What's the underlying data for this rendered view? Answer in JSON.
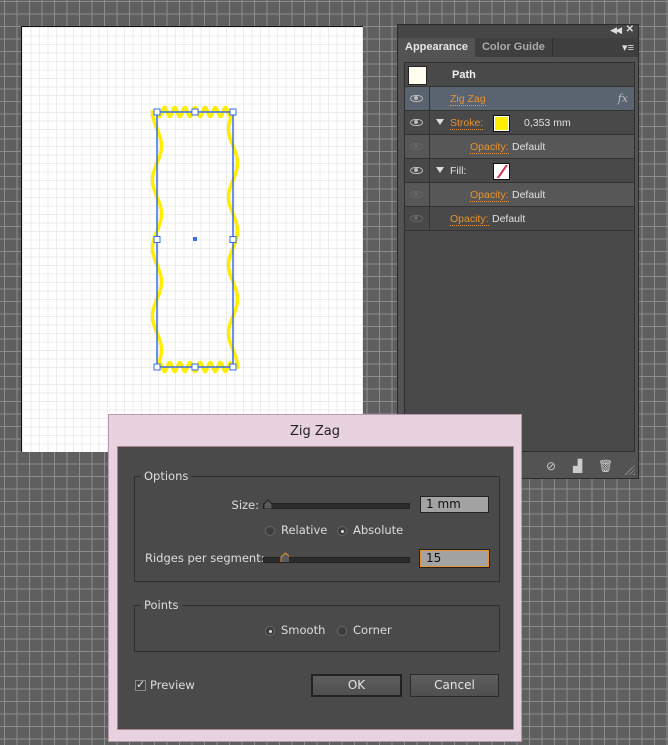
{
  "panel": {
    "tabs": [
      "Appearance",
      "Color Guide"
    ],
    "object_type": "Path",
    "rows": {
      "effect": "Zig Zag",
      "stroke_label": "Stroke:",
      "stroke_weight": "0,353 mm",
      "stroke_opacity_label": "Opacity:",
      "stroke_opacity_value": "Default",
      "fill_label": "Fill:",
      "fill_opacity_label": "Opacity:",
      "fill_opacity_value": "Default",
      "opacity_label": "Opacity:",
      "opacity_value": "Default"
    },
    "colors": {
      "stroke": "#ffee00",
      "fill": "none",
      "accent": "#e8932e"
    }
  },
  "dialog": {
    "title": "Zig Zag",
    "options_group": "Options",
    "size_label": "Size:",
    "size_value": "1 mm",
    "size_slider_fraction": 0.01,
    "relative_label": "Relative",
    "absolute_label": "Absolute",
    "size_mode": "Absolute",
    "ridges_label": "Ridges per segment:",
    "ridges_value": "15",
    "ridges_slider_fraction": 0.15,
    "points_group": "Points",
    "smooth_label": "Smooth",
    "corner_label": "Corner",
    "points_mode": "Smooth",
    "preview_label": "Preview",
    "preview_checked": true,
    "ok_label": "OK",
    "cancel_label": "Cancel"
  }
}
